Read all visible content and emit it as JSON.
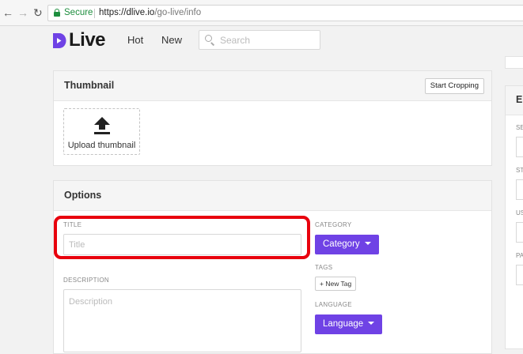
{
  "browser": {
    "back_glyph": "←",
    "forward_glyph": "→",
    "reload_glyph": "↻",
    "secure_label": "Secure",
    "url_host": "https://dlive.io",
    "url_path": "/go-live/info"
  },
  "header": {
    "logo_text": "Live",
    "brand_color": "#6f42e5",
    "nav": [
      "Hot",
      "New"
    ],
    "search_placeholder": "Search"
  },
  "thumbnail": {
    "title": "Thumbnail",
    "crop_button": "Start Cropping",
    "upload_label": "Upload thumbnail"
  },
  "options": {
    "title": "Options",
    "title_label": "TITLE",
    "title_placeholder": "Title",
    "description_label": "DESCRIPTION",
    "description_placeholder": "Description",
    "category_label": "CATEGORY",
    "category_button": "Category",
    "tags_label": "TAGS",
    "new_tag_button": "+ New Tag",
    "language_label": "LANGUAGE",
    "language_button": "Language"
  },
  "right_panel": {
    "title": "E",
    "labels": [
      "SE",
      "ST",
      "US",
      "PA"
    ]
  },
  "highlight_color": "#e8000d"
}
